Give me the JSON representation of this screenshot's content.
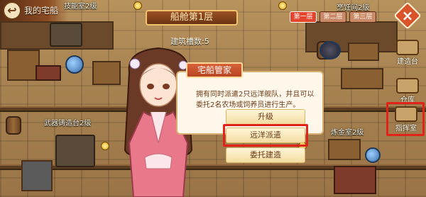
{
  "header": {
    "back_icon": "back-arrow-icon",
    "title": "我的宅船"
  },
  "floor": {
    "title": "船舱第1层",
    "build_slots": "建筑槽数:5"
  },
  "floor_tabs": [
    {
      "label": "第一层",
      "active": true
    },
    {
      "label": "第二层",
      "active": false
    },
    {
      "label": "第三层",
      "active": false
    }
  ],
  "stations": {
    "top_left": "技能室2级",
    "top_right": "烹饪间2级",
    "weapon": "武器铸造台2级",
    "alchemy": "炼金室2级"
  },
  "side_menu": [
    {
      "label": "建造台",
      "icon": "construction-icon"
    },
    {
      "label": "仓库",
      "icon": "warehouse-icon"
    },
    {
      "label": "指挥室",
      "icon": "command-room-icon"
    }
  ],
  "dialog": {
    "title": "宅船管家",
    "body": "拥有同时派遣2只远洋舰队，并且可以委托2名农场或饲养员进行生产。",
    "options": [
      "升级",
      "远洋派遣",
      "委托建造"
    ]
  },
  "colors": {
    "highlight": "#e2231a",
    "active_tab": "#e4452c",
    "dialog_title": "#d8633a"
  }
}
